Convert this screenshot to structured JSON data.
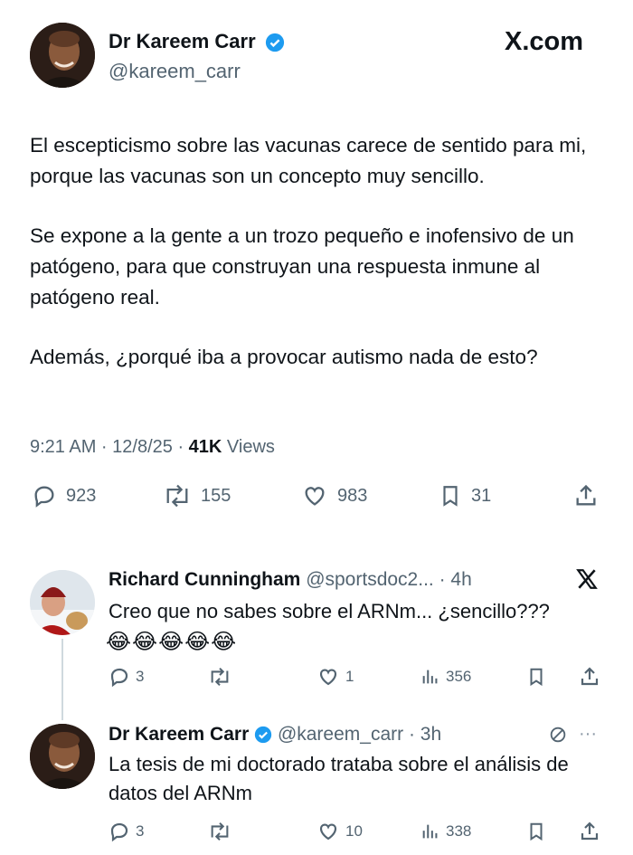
{
  "main_tweet": {
    "author_name": "Dr Kareem Carr",
    "handle": "@kareem_carr",
    "brand": "X.com",
    "paragraphs": [
      "El escepticismo sobre las vacunas carece de sentido para mi, porque las vacunas son un concepto muy sencillo.",
      "Se expone a la gente a un trozo pequeño e inofensivo de un patógeno, para que construyan una respuesta inmune al patógeno real.",
      "Además, ¿porqué iba a provocar autismo nada de esto?"
    ],
    "time": "9:21 AM · 12/8/25 · ",
    "views_count": "41K",
    "views_label": " Views",
    "replies": "923",
    "reposts": "155",
    "likes": "983",
    "bookmarks": "31"
  },
  "reply1": {
    "author_name": "Richard Cunningham",
    "handle_time": "@sportsdoc2... · 4h",
    "text": "Creo que no sabes sobre el ARNm... ¿sencillo???",
    "emojis": "😂😂😂😂😂",
    "replies": "3",
    "likes": "1",
    "views": "356"
  },
  "reply2": {
    "author_name": "Dr Kareem Carr",
    "handle_time": "@kareem_carr · 3h",
    "text": "La tesis de mi doctorado trataba sobre el análisis de datos del ARNm",
    "replies": "3",
    "likes": "10",
    "views": "338",
    "more": "···"
  },
  "colors": {
    "verified": "#1d9bf0",
    "muted": "#536471",
    "text": "#0f1419"
  },
  "icons": [
    "verified-badge-icon",
    "x-logo-icon",
    "reply-icon",
    "repost-icon",
    "like-icon",
    "bookmark-icon",
    "share-icon",
    "views-icon",
    "edit-icon"
  ]
}
